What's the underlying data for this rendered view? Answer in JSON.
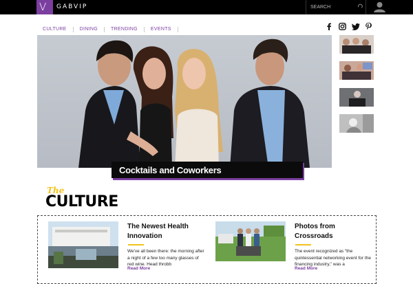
{
  "header": {
    "logo_letter": "V",
    "brand": "GABVIP",
    "search_placeholder": "SEARCH"
  },
  "nav": {
    "items": [
      "CULTURE",
      "DINING",
      "TRENDING",
      "EVENTS"
    ]
  },
  "social": [
    "facebook-icon",
    "instagram-icon",
    "twitter-icon",
    "pinterest-icon"
  ],
  "hero": {
    "caption": "Cocktails and Coworkers"
  },
  "section": {
    "the": "The",
    "title": "CULTURE"
  },
  "cards": [
    {
      "title": "The Newest Health Innovation",
      "desc": "We've all been there: the morning after a night of a few too many glasses of red wine. Head throbb",
      "more": "Read More"
    },
    {
      "title": "Photos from Crossroads",
      "desc": "The event recognized as “the quintessential networking event for the financing industry,” was a",
      "more": "Read More"
    }
  ],
  "colors": {
    "accent": "#7b3fa0",
    "highlight": "#f2c21b",
    "topbar": "#000000"
  }
}
